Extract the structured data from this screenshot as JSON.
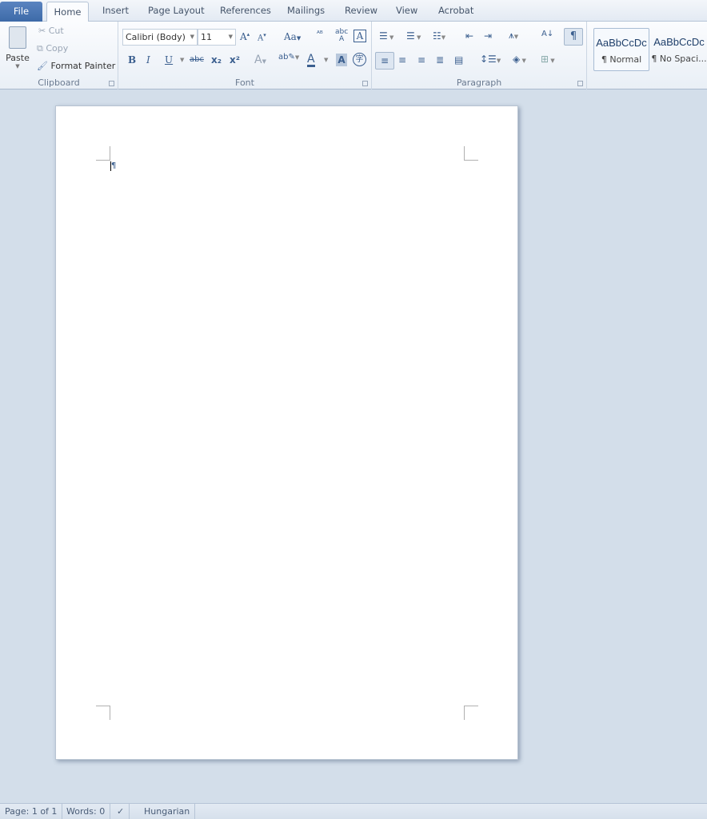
{
  "tabs": {
    "file": "File",
    "home": "Home",
    "insert": "Insert",
    "page_layout": "Page Layout",
    "references": "References",
    "mailings": "Mailings",
    "review": "Review",
    "view": "View",
    "acrobat": "Acrobat"
  },
  "clipboard": {
    "label": "Clipboard",
    "paste": "Paste",
    "cut": "Cut",
    "copy": "Copy",
    "format_painter": "Format Painter"
  },
  "font": {
    "label": "Font",
    "family": "Calibri (Body)",
    "size": "11",
    "bold": "B",
    "italic": "I",
    "underline": "U",
    "strike": "abc",
    "sub": "x₂",
    "sup": "x²",
    "change_case": "Aa",
    "font_color": "A"
  },
  "paragraph": {
    "label": "Paragraph",
    "show_marks": "¶"
  },
  "styles": [
    {
      "preview": "AaBbCcDc",
      "name": "¶ Normal"
    },
    {
      "preview": "AaBbCcDc",
      "name": "¶ No Spaci..."
    }
  ],
  "document": {
    "cursor_mark": "¶"
  },
  "status": {
    "page": "Page: 1 of 1",
    "words": "Words: 0",
    "language": "Hungarian"
  },
  "colors": {
    "accent": "#3d6aa8",
    "workspace": "#d3deea"
  }
}
